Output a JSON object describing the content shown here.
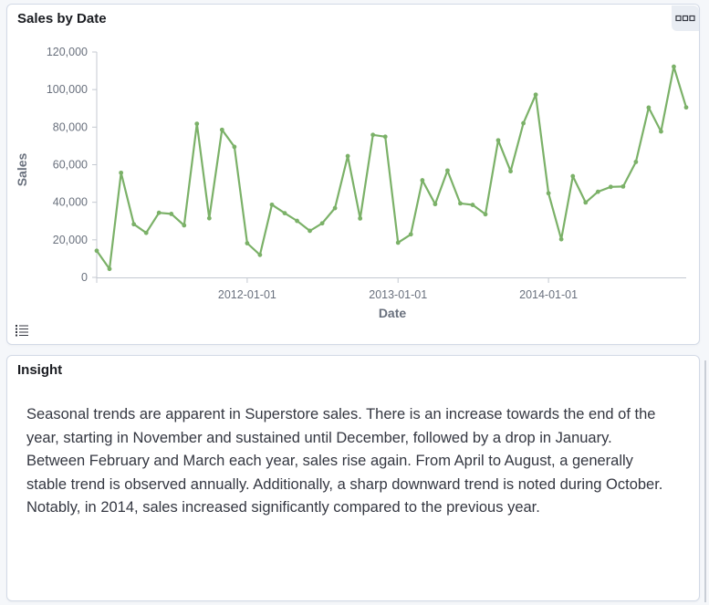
{
  "chart_panel": {
    "title": "Sales by Date",
    "options_icon": "ellipsis-boxes-icon",
    "legend_icon": "list-icon"
  },
  "insight_panel": {
    "title": "Insight",
    "text": "Seasonal trends are apparent in Superstore sales. There is an increase towards the end of the year, starting in November and sustained until December, followed by a drop in January. Between February and March each year, sales rise again. From April to August, a generally stable trend is observed annually. Additionally, a sharp downward trend is noted during October. Notably, in 2014, sales increased significantly compared to the previous year."
  },
  "chart_data": {
    "type": "line",
    "title": "",
    "xlabel": "Date",
    "ylabel": "Sales",
    "x_ticks": [
      "2012-01-01",
      "2013-01-01",
      "2014-01-01"
    ],
    "y_ticks": [
      "0",
      "20,000",
      "40,000",
      "60,000",
      "80,000",
      "100,000",
      "120,000"
    ],
    "ylim": [
      0,
      120000
    ],
    "xlim": [
      "2011-01-01",
      "2014-12-01"
    ],
    "grid": false,
    "color": "#7bb168",
    "series": [
      {
        "x": [
          "2011-01-01",
          "2011-02-01",
          "2011-03-01",
          "2011-04-01",
          "2011-05-01",
          "2011-06-01",
          "2011-07-01",
          "2011-08-01",
          "2011-09-01",
          "2011-10-01",
          "2011-11-01",
          "2011-12-01",
          "2012-01-01",
          "2012-02-01",
          "2012-03-01",
          "2012-04-01",
          "2012-05-01",
          "2012-06-01",
          "2012-07-01",
          "2012-08-01",
          "2012-09-01",
          "2012-10-01",
          "2012-11-01",
          "2012-12-01",
          "2013-01-01",
          "2013-02-01",
          "2013-03-01",
          "2013-04-01",
          "2013-05-01",
          "2013-06-01",
          "2013-07-01",
          "2013-08-01",
          "2013-09-01",
          "2013-10-01",
          "2013-11-01",
          "2013-12-01",
          "2014-01-01",
          "2014-02-01",
          "2014-03-01",
          "2014-04-01",
          "2014-05-01",
          "2014-06-01",
          "2014-07-01",
          "2014-08-01",
          "2014-09-01",
          "2014-10-01",
          "2014-11-01",
          "2014-12-01"
        ],
        "values": [
          14200,
          4500,
          55700,
          28300,
          23700,
          34400,
          33800,
          27700,
          81800,
          31500,
          78600,
          69500,
          18200,
          12000,
          38700,
          34200,
          30100,
          24800,
          28800,
          36900,
          64600,
          31400,
          75900,
          74900,
          18500,
          22900,
          51700,
          39000,
          56900,
          39400,
          38600,
          33600,
          73000,
          56500,
          82100,
          97300,
          44800,
          20300,
          53900,
          39900,
          45600,
          48200,
          48400,
          61500,
          90400,
          77700,
          112200,
          90500
        ]
      }
    ]
  }
}
